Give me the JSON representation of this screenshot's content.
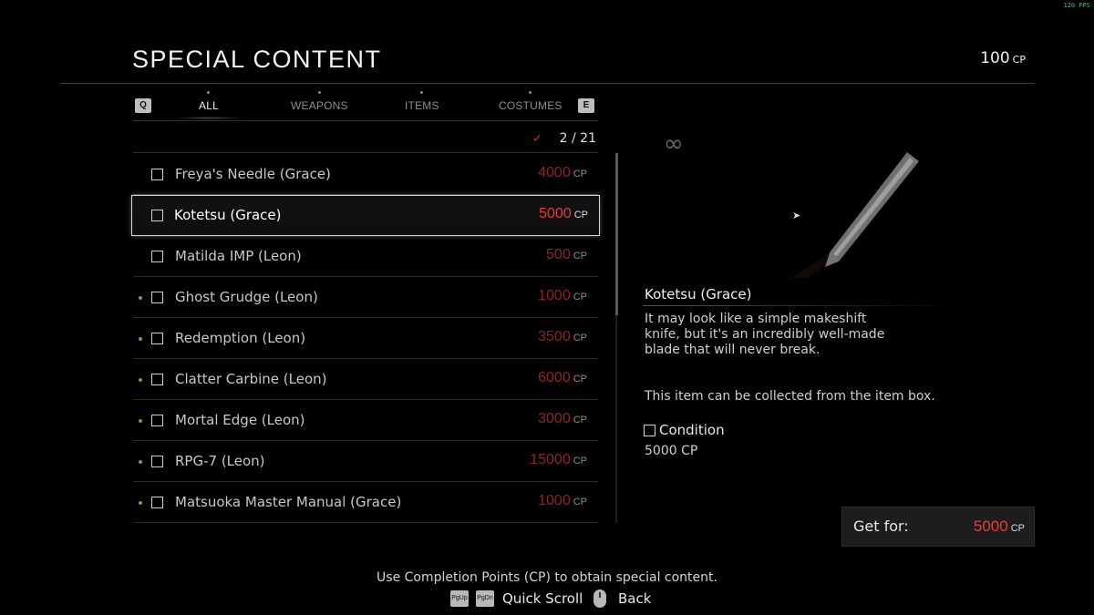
{
  "header": {
    "title": "SPECIAL CONTENT",
    "cp_value": "100",
    "cp_unit": "CP",
    "fps": "120 FPS"
  },
  "tabs": {
    "left_key": "Q",
    "right_key": "E",
    "items": [
      {
        "label": "ALL",
        "active": true
      },
      {
        "label": "WEAPONS",
        "active": false
      },
      {
        "label": "ITEMS",
        "active": false
      },
      {
        "label": "COSTUMES",
        "active": false
      }
    ]
  },
  "counter": {
    "value": "2 / 21",
    "icon": "checkmark-icon"
  },
  "list": [
    {
      "name": "Freya's Needle (Grace)",
      "price": "4000",
      "unit": "CP",
      "new": false
    },
    {
      "name": "Kotetsu (Grace)",
      "price": "5000",
      "unit": "CP",
      "new": false,
      "selected": true
    },
    {
      "name": "Matilda IMP (Leon)",
      "price": "500",
      "unit": "CP",
      "new": false
    },
    {
      "name": "Ghost Grudge (Leon)",
      "price": "1000",
      "unit": "CP",
      "new": true
    },
    {
      "name": "Redemption (Leon)",
      "price": "3500",
      "unit": "CP",
      "new": true
    },
    {
      "name": "Clatter Carbine (Leon)",
      "price": "6000",
      "unit": "CP",
      "new": true
    },
    {
      "name": "Mortal Edge (Leon)",
      "price": "3000",
      "unit": "CP",
      "new": true
    },
    {
      "name": "RPG-7 (Leon)",
      "price": "15000",
      "unit": "CP",
      "new": true
    },
    {
      "name": "Matsuoka Master Manual (Grace)",
      "price": "1000",
      "unit": "CP",
      "new": true
    }
  ],
  "detail": {
    "infinity_symbol": "∞",
    "title": "Kotetsu (Grace)",
    "description": "It may look like a simple makeshift knife, but it's an incredibly well-made blade that will never break.",
    "note": "This item can be collected from the item box.",
    "condition_label": "Condition",
    "condition_value": "5000 CP"
  },
  "purchase": {
    "label": "Get for:",
    "price": "5000",
    "unit": "CP"
  },
  "footer": {
    "hint": "Use Completion Points (CP) to obtain special content.",
    "pgup_key": "PgUp",
    "pgdn_key": "PgDn",
    "scroll_label": "Quick Scroll",
    "back_label": "Back"
  },
  "colors": {
    "price_red": "#8b2525",
    "selected_price_red": "#e83c3c",
    "new_dot": "#8a9430"
  }
}
